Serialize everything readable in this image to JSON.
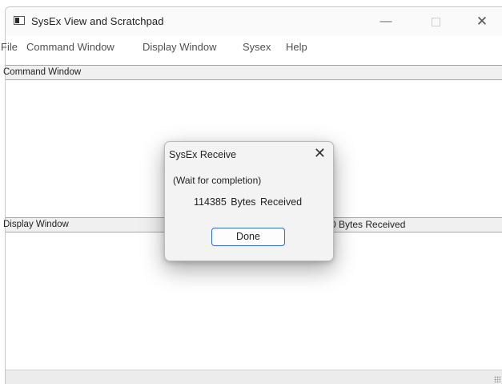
{
  "window": {
    "title": "SysEx View and Scratchpad",
    "controls": {
      "minimize": "—",
      "close": "✕"
    }
  },
  "menu": [
    "File",
    "Command Window",
    "Display Window",
    "Sysex",
    "Help"
  ],
  "command_pane": {
    "header": "Command Window"
  },
  "display_pane": {
    "header": "Display Window",
    "status": "0  Bytes Received"
  },
  "dialog": {
    "title": "SysEx Receive",
    "close": "✕",
    "wait_text": "(Wait for completion)",
    "bytes_text": "114385  Bytes Received",
    "button_label": "Done"
  },
  "colors": {
    "accent": "#2f6fd0",
    "pane_header_bg": "#f0f0f0"
  }
}
